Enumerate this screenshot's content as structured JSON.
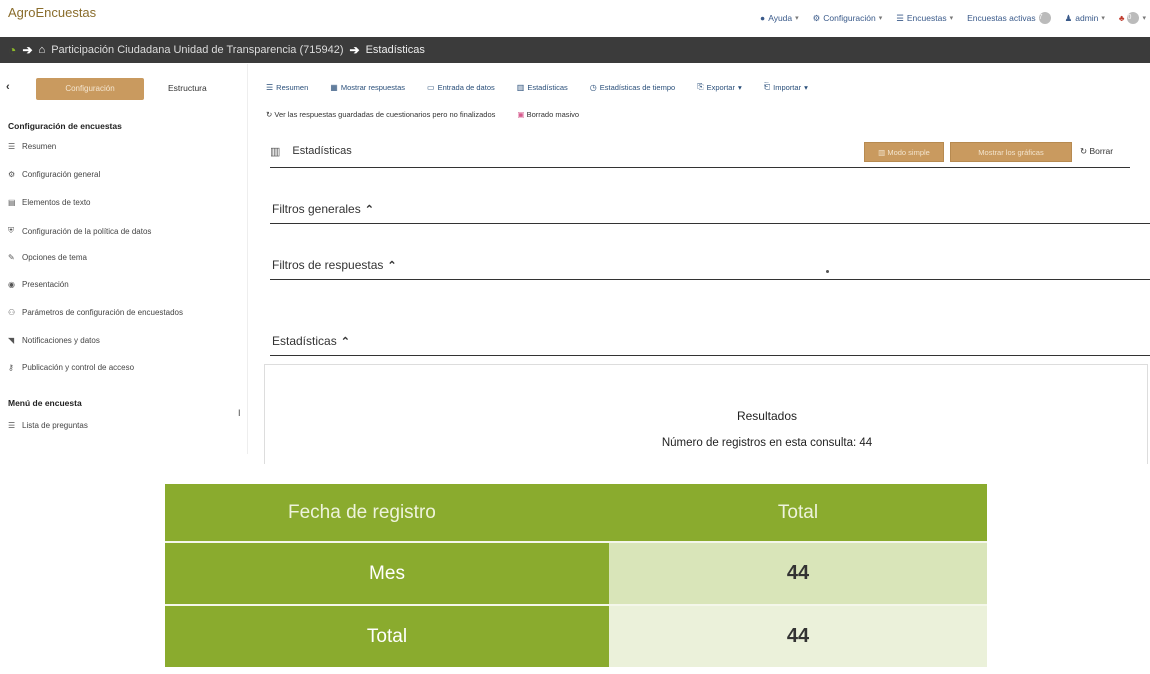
{
  "app": {
    "brand": "AgroEncuestas"
  },
  "topnav": {
    "help": "Ayuda",
    "config": "Configuración",
    "surveys": "Encuestas",
    "active_surveys": "Encuestas activas",
    "active_count": "7",
    "user": "admin",
    "notifications": "0"
  },
  "breadcrumb": {
    "survey": "Participación Ciudadana Unidad de Transparencia (715942)",
    "current": "Estadísticas"
  },
  "sidebar": {
    "tab_config": "Configuración",
    "tab_structure": "Estructura",
    "section_config": "Configuración de encuestas",
    "items": [
      {
        "icon": "list-icon",
        "label": "Resumen"
      },
      {
        "icon": "gears-icon",
        "label": "Configuración general"
      },
      {
        "icon": "file-text-icon",
        "label": "Elementos de texto"
      },
      {
        "icon": "shield-icon",
        "label": "Configuración de la política de datos"
      },
      {
        "icon": "brush-icon",
        "label": "Opciones de tema"
      },
      {
        "icon": "eye-icon",
        "label": "Presentación"
      },
      {
        "icon": "users-cog-icon",
        "label": "Parámetros de configuración de encuestados"
      },
      {
        "icon": "rss-icon",
        "label": "Notificaciones y datos"
      },
      {
        "icon": "key-icon",
        "label": "Publicación y control de acceso"
      }
    ],
    "section_menu": "Menú de encuesta",
    "menu_items": [
      {
        "icon": "list-icon",
        "label": "Lista de preguntas"
      }
    ]
  },
  "toolbar": {
    "summary": "Resumen",
    "show_responses": "Mostrar respuestas",
    "data_entry": "Entrada de datos",
    "statistics": "Estadísticas",
    "time_statistics": "Estadísticas de tiempo",
    "export": "Exportar",
    "import": "Importar",
    "saved_unfinished": "Ver las respuestas guardadas de cuestionarios pero no finalizados",
    "mass_delete": "Borrado masivo"
  },
  "stats": {
    "title": "Estadísticas",
    "simple_mode": "Modo simple",
    "show_graphs": "Mostrar los gráficas",
    "clear": "Borrar",
    "general_filters": "Filtros generales",
    "response_filters": "Filtros de respuestas",
    "statistics_section": "Estadísticas",
    "results_title": "Resultados",
    "records_label": "Número de registros en esta consulta: 44"
  },
  "table": {
    "header_left": "Fecha de registro",
    "header_right": "Total",
    "rows": [
      {
        "label": "Mes",
        "value": "44"
      },
      {
        "label": "Total",
        "value": "44"
      }
    ]
  },
  "colors": {
    "accent_green": "#8aab2e",
    "button_tan": "#c99a5f",
    "dark_bar": "#3b3b3b"
  }
}
